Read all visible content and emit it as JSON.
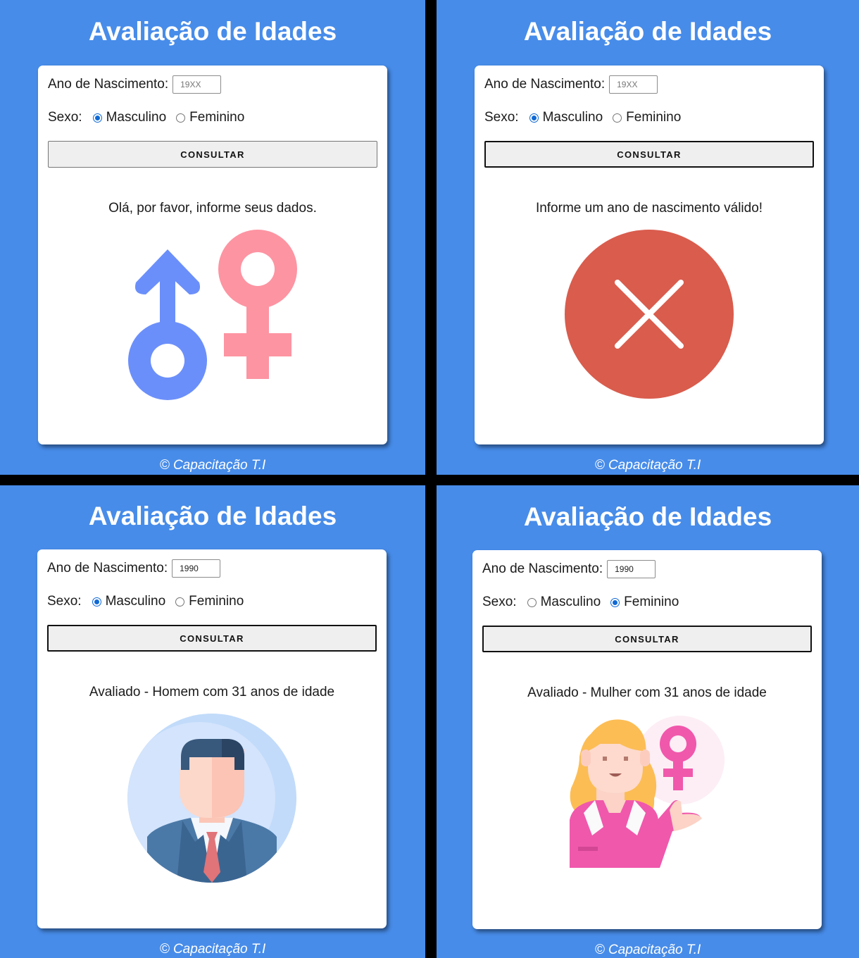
{
  "panels": [
    {
      "title": "Avaliação de Idades",
      "year_label": "Ano de Nascimento:",
      "year_value": "",
      "year_placeholder": "19XX",
      "sex_label": "Sexo:",
      "male_label": "Masculino",
      "female_label": "Feminino",
      "selected": "male",
      "button_label": "CONSULTAR",
      "message": "Olá, por favor, informe seus dados.",
      "image_icon": "gender-symbols-icon",
      "footer": "© Capacitação T.I"
    },
    {
      "title": "Avaliação de Idades",
      "year_label": "Ano de Nascimento:",
      "year_value": "",
      "year_placeholder": "19XX",
      "sex_label": "Sexo:",
      "male_label": "Masculino",
      "female_label": "Feminino",
      "selected": "male",
      "button_label": "CONSULTAR",
      "message": "Informe um ano de nascimento válido!",
      "image_icon": "error-x-icon",
      "footer": "© Capacitação T.I"
    },
    {
      "title": "Avaliação de Idades",
      "year_label": "Ano de Nascimento:",
      "year_value": "1990",
      "year_placeholder": "19XX",
      "sex_label": "Sexo:",
      "male_label": "Masculino",
      "female_label": "Feminino",
      "selected": "male",
      "button_label": "CONSULTAR",
      "message": "Avaliado - Homem com 31 anos de idade",
      "image_icon": "businessman-avatar-icon",
      "footer": "© Capacitação T.I"
    },
    {
      "title": "Avaliação de Idades",
      "year_label": "Ano de Nascimento:",
      "year_value": "1990",
      "year_placeholder": "19XX",
      "sex_label": "Sexo:",
      "male_label": "Masculino",
      "female_label": "Feminino",
      "selected": "female",
      "button_label": "CONSULTAR",
      "message": "Avaliado - Mulher com 31 anos de idade",
      "image_icon": "businesswoman-avatar-icon",
      "footer": "© Capacitação T.I"
    }
  ],
  "colors": {
    "background": "#478ce9",
    "divider": "#000000",
    "male_symbol": "#6b8ffa",
    "female_symbol": "#fd94a2",
    "error_circle": "#d95c4d",
    "radio_checked": "#0f69d5"
  }
}
